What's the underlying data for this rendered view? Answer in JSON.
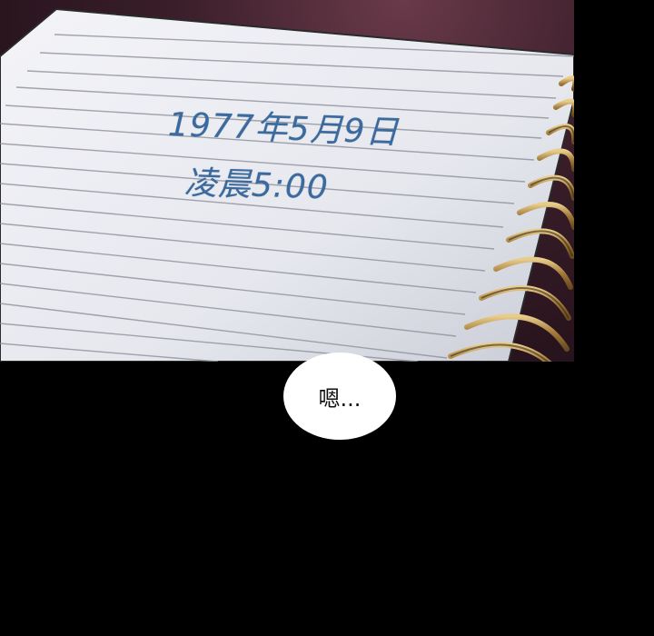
{
  "notebook": {
    "date_text": "1977年5月9日",
    "time_text": "凌晨5:00",
    "ink_color": "#3a6a9e",
    "paper_color": "#eef0f4",
    "ring_color": "#b08a4a"
  },
  "speech_bubble": {
    "text": "嗯..."
  }
}
